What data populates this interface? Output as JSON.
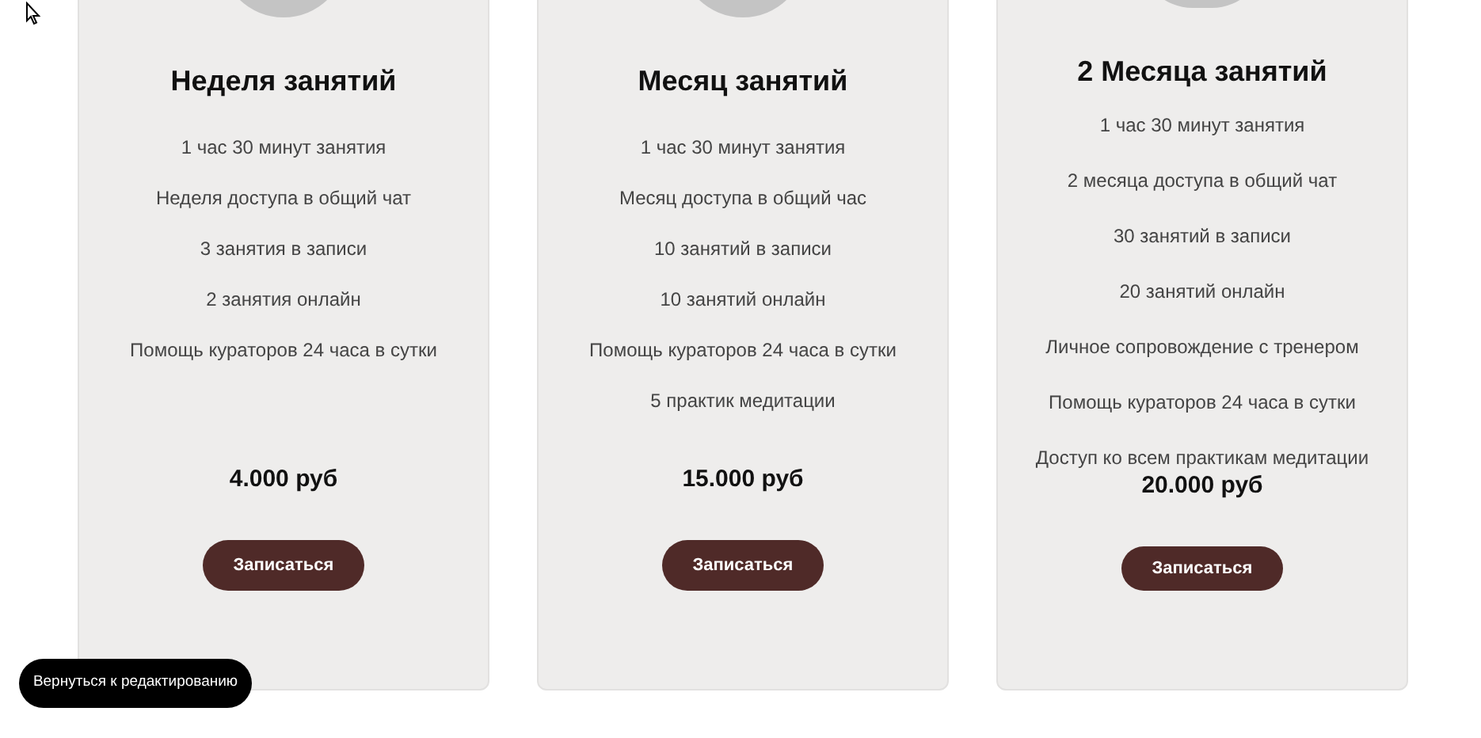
{
  "plans": [
    {
      "title": "Неделя занятий",
      "features": [
        "1 час 30 минут занятия",
        "Неделя доступа в общий чат",
        "3 занятия в записи",
        "2 занятия онлайн",
        "Помощь кураторов 24 часа в сутки"
      ],
      "price": "4.000 руб",
      "button": "Записаться"
    },
    {
      "title": "Месяц занятий",
      "features": [
        "1 час 30 минут занятия",
        "Месяц доступа в общий час",
        "10 занятий в записи",
        "10 занятий онлайн",
        "Помощь кураторов 24 часа в сутки",
        "5 практик медитации"
      ],
      "price": "15.000 руб",
      "button": "Записаться"
    },
    {
      "title": "2 Месяца занятий",
      "features": [
        "1 час 30 минут занятия",
        "2 месяца доступа в общий чат",
        "30 занятий в записи",
        "20 занятий онлайн",
        "Личное сопровождение с тренером",
        "Помощь кураторов 24 часа в сутки",
        "Доступ ко всем практикам медитации"
      ],
      "price": "20.000 руб",
      "button": "Записаться"
    }
  ],
  "edit_button": "Вернуться к редактированию"
}
